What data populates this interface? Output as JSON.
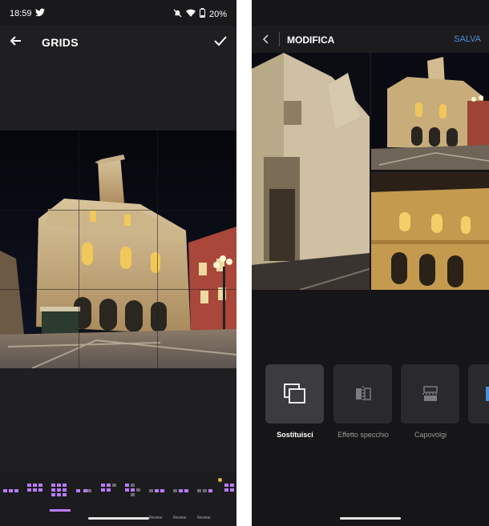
{
  "left": {
    "status": {
      "time": "18:59",
      "battery": "20%"
    },
    "toolbar": {
      "title": "GRIDS"
    },
    "grid_options": [
      {
        "id": "grid-1",
        "label": ""
      },
      {
        "id": "grid-2",
        "label": ""
      },
      {
        "id": "grid-3",
        "label": ""
      },
      {
        "id": "grid-4",
        "label": ""
      },
      {
        "id": "grid-5",
        "label": ""
      },
      {
        "id": "grid-6",
        "label": ""
      },
      {
        "id": "grid-7",
        "label": "Review"
      },
      {
        "id": "grid-8",
        "label": "Review"
      },
      {
        "id": "grid-9",
        "label": "Review"
      },
      {
        "id": "grid-10",
        "label": ""
      }
    ],
    "selected_grid": 3,
    "accent": "#b97cff",
    "badge_color": "#e5b93a"
  },
  "right": {
    "toolbar": {
      "title": "MODIFICA",
      "save": "SALVA"
    },
    "tools": [
      {
        "label": "Sostituisci",
        "icon": "replace-icon",
        "selected": true
      },
      {
        "label": "Effetto specchio",
        "icon": "mirror-icon",
        "selected": false
      },
      {
        "label": "Capovolgi",
        "icon": "flip-icon",
        "selected": false
      },
      {
        "label": "",
        "icon": "more-tool-icon",
        "selected": false
      }
    ],
    "accent": "#4a90d9"
  }
}
